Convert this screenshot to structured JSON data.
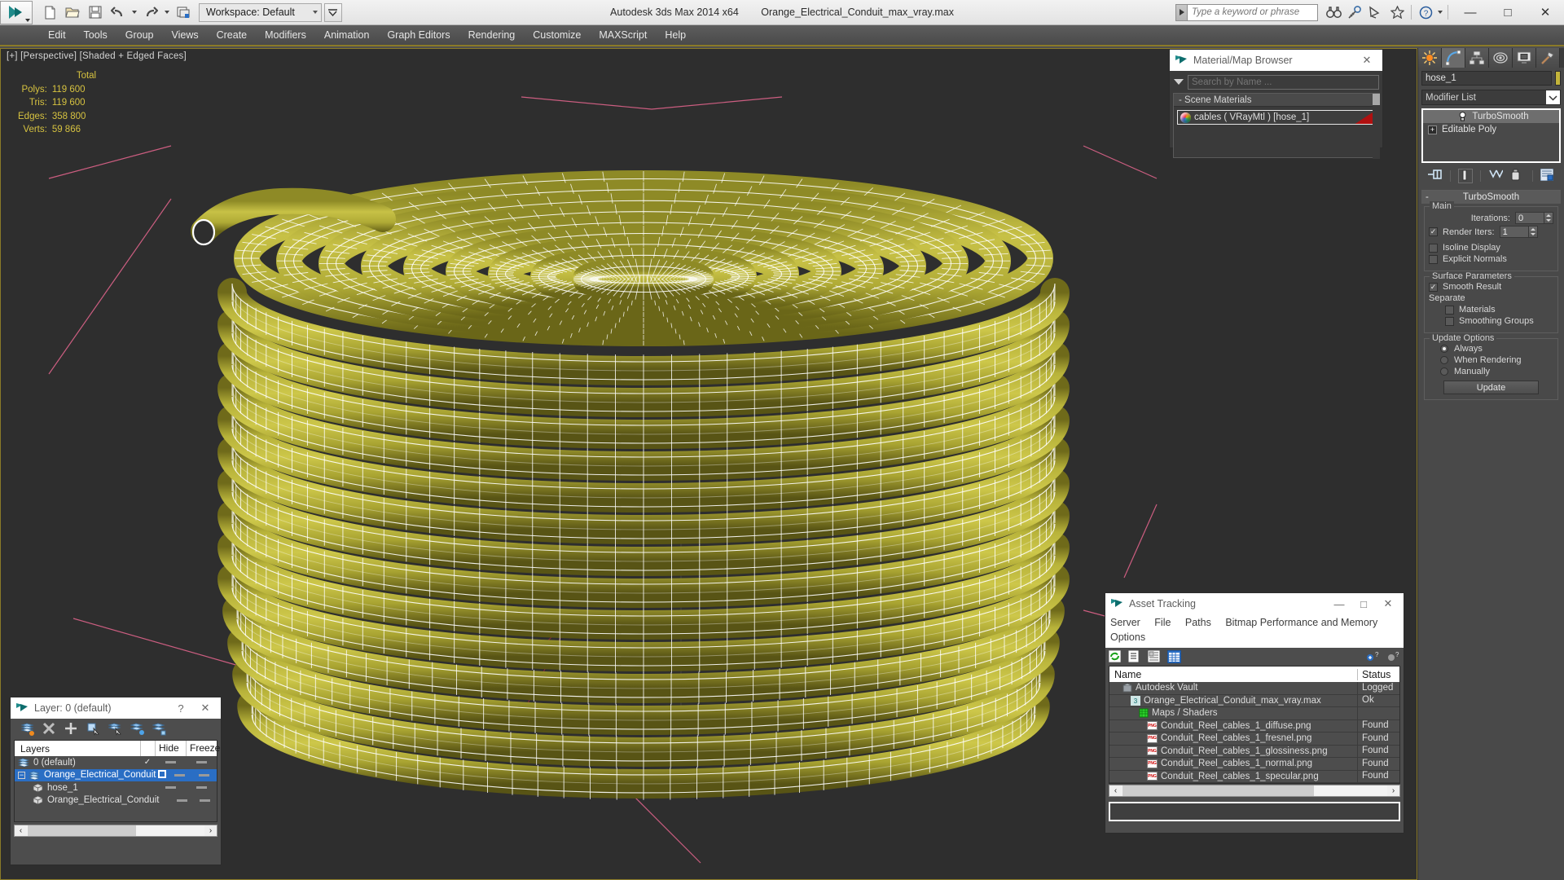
{
  "app": {
    "title": "Autodesk 3ds Max  2014 x64",
    "file": "Orange_Electrical_Conduit_max_vray.max",
    "workspace_label": "Workspace: Default",
    "search_placeholder": "Type a keyword or phrase"
  },
  "menu": {
    "items": [
      "Edit",
      "Tools",
      "Group",
      "Views",
      "Create",
      "Modifiers",
      "Animation",
      "Graph Editors",
      "Rendering",
      "Customize",
      "MAXScript",
      "Help"
    ]
  },
  "viewport": {
    "label": "[+] [Perspective] [Shaded + Edged Faces]",
    "stats_header": "Total",
    "stats": [
      {
        "key": "Polys:",
        "value": "119 600"
      },
      {
        "key": "Tris:",
        "value": "119 600"
      },
      {
        "key": "Edges:",
        "value": "358 800"
      },
      {
        "key": "Verts:",
        "value": "59 866"
      }
    ],
    "mesh_color": "#b3ae33",
    "wire_color": "#ffffff",
    "background": "#2e2e2e",
    "gizmo_color": "#e8668f"
  },
  "material_browser": {
    "title": "Material/Map Browser",
    "search_placeholder": "Search by Name ...",
    "group_label": "- Scene Materials",
    "material": "cables  ( VRayMtl )  [hose_1]",
    "swatch_color": "#b01010",
    "close_label": "✕"
  },
  "command_panel": {
    "tabs": [
      "create-tab",
      "modify-tab",
      "hierarchy-tab",
      "motion-tab",
      "display-tab",
      "utilities-tab"
    ],
    "object_name": "hose_1",
    "object_color": "#c3b43a",
    "modifier_list_label": "Modifier List",
    "stack": [
      {
        "label": "TurboSmooth",
        "icon": "bulb-icon"
      },
      {
        "label": "Editable Poly",
        "icon": "plus-box-icon"
      }
    ],
    "rollout": {
      "title": "TurboSmooth",
      "collapse_marker": "-",
      "groups": [
        {
          "label": "Main",
          "fields": [
            {
              "type": "spinner",
              "label": "Iterations:",
              "value": "0"
            },
            {
              "type": "checkbox-spinner",
              "label": "Render Iters:",
              "value": "1",
              "checked": true
            },
            {
              "type": "checkbox",
              "label": "Isoline Display",
              "checked": false
            },
            {
              "type": "checkbox",
              "label": "Explicit Normals",
              "checked": false
            }
          ]
        },
        {
          "label": "Surface Parameters",
          "fields": [
            {
              "type": "checkbox",
              "label": "Smooth Result",
              "checked": true
            },
            {
              "type": "text",
              "label": "Separate"
            },
            {
              "type": "checkbox",
              "label": "Materials",
              "checked": false,
              "indent": true
            },
            {
              "type": "checkbox",
              "label": "Smoothing Groups",
              "checked": false,
              "indent": true
            }
          ]
        },
        {
          "label": "Update Options",
          "fields": [
            {
              "type": "radio",
              "label": "Always",
              "checked": true
            },
            {
              "type": "radio",
              "label": "When Rendering",
              "checked": false
            },
            {
              "type": "radio",
              "label": "Manually",
              "checked": false
            },
            {
              "type": "button",
              "label": "Update"
            }
          ]
        }
      ]
    }
  },
  "asset_tracking": {
    "title": "Asset Tracking",
    "menu": [
      "Server",
      "File",
      "Paths",
      "Bitmap Performance and Memory",
      "Options"
    ],
    "columns": [
      "Name",
      "Status"
    ],
    "rows": [
      {
        "name": "Autodesk Vault",
        "status": "Logged",
        "indent": 1,
        "icon": "vault-icon"
      },
      {
        "name": "Orange_Electrical_Conduit_max_vray.max",
        "status": "Ok",
        "indent": 2,
        "icon": "max-file-icon"
      },
      {
        "name": "Maps / Shaders",
        "status": "",
        "indent": 3,
        "icon": "maps-icon"
      },
      {
        "name": "Conduit_Reel_cables_1_diffuse.png",
        "status": "Found",
        "indent": 4,
        "icon": "png-icon"
      },
      {
        "name": "Conduit_Reel_cables_1_fresnel.png",
        "status": "Found",
        "indent": 4,
        "icon": "png-icon"
      },
      {
        "name": "Conduit_Reel_cables_1_glossiness.png",
        "status": "Found",
        "indent": 4,
        "icon": "png-icon"
      },
      {
        "name": "Conduit_Reel_cables_1_normal.png",
        "status": "Found",
        "indent": 4,
        "icon": "png-icon"
      },
      {
        "name": "Conduit_Reel_cables_1_specular.png",
        "status": "Found",
        "indent": 4,
        "icon": "png-icon"
      }
    ],
    "window_buttons": {
      "minimize": "—",
      "maximize": "□",
      "close": "✕"
    },
    "scroll_left": "‹",
    "scroll_right": "›"
  },
  "layer_manager": {
    "title": "Layer: 0 (default)",
    "help_label": "?",
    "close_label": "✕",
    "columns": [
      "Layers",
      "Hide",
      "Freeze"
    ],
    "rows": [
      {
        "name": "0 (default)",
        "indent": 1,
        "current": "✓",
        "selected": false,
        "icon": "layer-icon",
        "expander": ""
      },
      {
        "name": "Orange_Electrical_Conduit",
        "indent": 1,
        "current": "",
        "selected": true,
        "icon": "layer-icon",
        "expander": "−"
      },
      {
        "name": "hose_1",
        "indent": 2,
        "current": "",
        "selected": false,
        "icon": "object-icon",
        "expander": ""
      },
      {
        "name": "Orange_Electrical_Conduit",
        "indent": 2,
        "current": "",
        "selected": false,
        "icon": "object-icon",
        "expander": ""
      }
    ],
    "scroll_left": "‹",
    "scroll_right": "›"
  },
  "window_controls": {
    "minimize": "—",
    "maximize": "□",
    "close": "✕"
  }
}
